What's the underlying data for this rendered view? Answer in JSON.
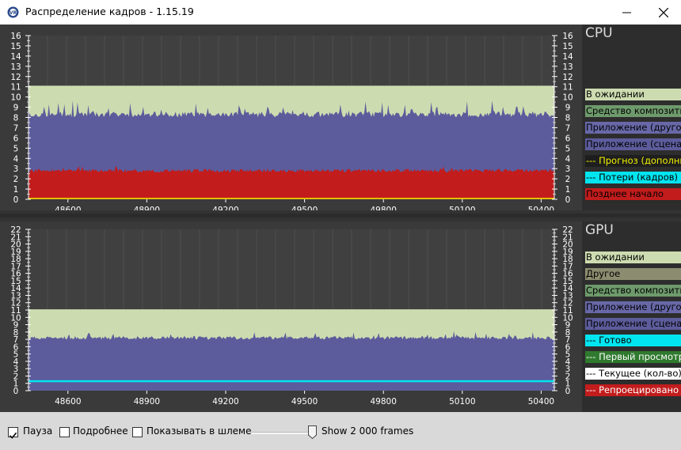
{
  "window": {
    "title": "Распределение кадров - 1.15.19"
  },
  "cpu": {
    "title": "CPU",
    "y_ticks": [
      "0",
      "1",
      "2",
      "3",
      "4",
      "5",
      "6",
      "7",
      "8",
      "9",
      "10",
      "11",
      "12",
      "13",
      "14",
      "15",
      "16"
    ],
    "x_ticks": [
      "48600",
      "48900",
      "49200",
      "49500",
      "49800",
      "50100",
      "50400"
    ],
    "legend": [
      {
        "label": "В ожидании",
        "bg": "#cddcb0",
        "fg": "#000000"
      },
      {
        "label": "Средство композитин",
        "bg": "#6e9a6c",
        "fg": "#000000"
      },
      {
        "label": "Приложение (другое)",
        "bg": "#6868a8",
        "fg": "#000000"
      },
      {
        "label": "Приложение (сцена)",
        "bg": "#5c5c9c",
        "fg": "#000000"
      },
      {
        "label": "--- Прогноз (дополни",
        "bg": "#1e1e1e",
        "fg": "#f2f200"
      },
      {
        "label": "--- Потери (кадров)",
        "bg": "#00e5f0",
        "fg": "#000000"
      },
      {
        "label": "Позднее начало",
        "bg": "#c21c1c",
        "fg": "#000000"
      }
    ]
  },
  "gpu": {
    "title": "GPU",
    "y_ticks": [
      "0",
      "1",
      "2",
      "3",
      "4",
      "5",
      "6",
      "7",
      "8",
      "9",
      "10",
      "11",
      "12",
      "13",
      "14",
      "15",
      "16",
      "17",
      "18",
      "19",
      "20",
      "21",
      "22"
    ],
    "x_ticks": [
      "48600",
      "48900",
      "49200",
      "49500",
      "49800",
      "50100",
      "50400"
    ],
    "legend": [
      {
        "label": "В ожидании",
        "bg": "#cddcb0",
        "fg": "#000000"
      },
      {
        "label": "Другое",
        "bg": "#8c8c70",
        "fg": "#000000"
      },
      {
        "label": "Средство композитин",
        "bg": "#6e9a6c",
        "fg": "#000000"
      },
      {
        "label": "Приложение (другое)",
        "bg": "#6868a8",
        "fg": "#000000"
      },
      {
        "label": "Приложение (сцена)",
        "bg": "#5c5c9c",
        "fg": "#000000"
      },
      {
        "label": "--- Готово",
        "bg": "#00e5f0",
        "fg": "#000000"
      },
      {
        "label": "--- Первый просмотр",
        "bg": "#2f7a2f",
        "fg": "#ffffff"
      },
      {
        "label": "--- Текущее (кол-во)",
        "bg": "#ffffff",
        "fg": "#000000"
      },
      {
        "label": "--- Репроецировано",
        "bg": "#c21c1c",
        "fg": "#ffffff"
      }
    ]
  },
  "controls": {
    "pause_label": "Пауза",
    "pause_checked": true,
    "details_label": "Подробнее",
    "details_checked": false,
    "headset_label": "Показывать в шлеме",
    "headset_checked": false,
    "frames_label": "Show 2 000 frames"
  },
  "chart_data": [
    {
      "type": "area",
      "title": "CPU",
      "x_ticks": [
        48600,
        48900,
        49200,
        49500,
        49800,
        50100,
        50400
      ],
      "xlim": [
        48450,
        50450
      ],
      "ylim": [
        0,
        16
      ],
      "series": [
        {
          "name": "Позднее начало",
          "color": "#c21c1c",
          "typical_top": 2.8
        },
        {
          "name": "Приложение (сцена)",
          "color": "#5c5c9c",
          "typical_top": 8.3
        },
        {
          "name": "В ожидании",
          "color": "#cddcb0",
          "typical_top": 11.1
        }
      ],
      "legend_position": "right"
    },
    {
      "type": "area",
      "title": "GPU",
      "x_ticks": [
        48600,
        48900,
        49200,
        49500,
        49800,
        50100,
        50400
      ],
      "xlim": [
        48450,
        50450
      ],
      "ylim": [
        0,
        22
      ],
      "series": [
        {
          "name": "Приложение (сцена)",
          "color": "#5c5c9c",
          "typical_top": 7.2
        },
        {
          "name": "В ожидании",
          "color": "#cddcb0",
          "typical_top": 11.1
        },
        {
          "name": "--- Готово",
          "color": "#00e5f0",
          "typical_top": 1.3
        }
      ],
      "legend_position": "right"
    }
  ]
}
